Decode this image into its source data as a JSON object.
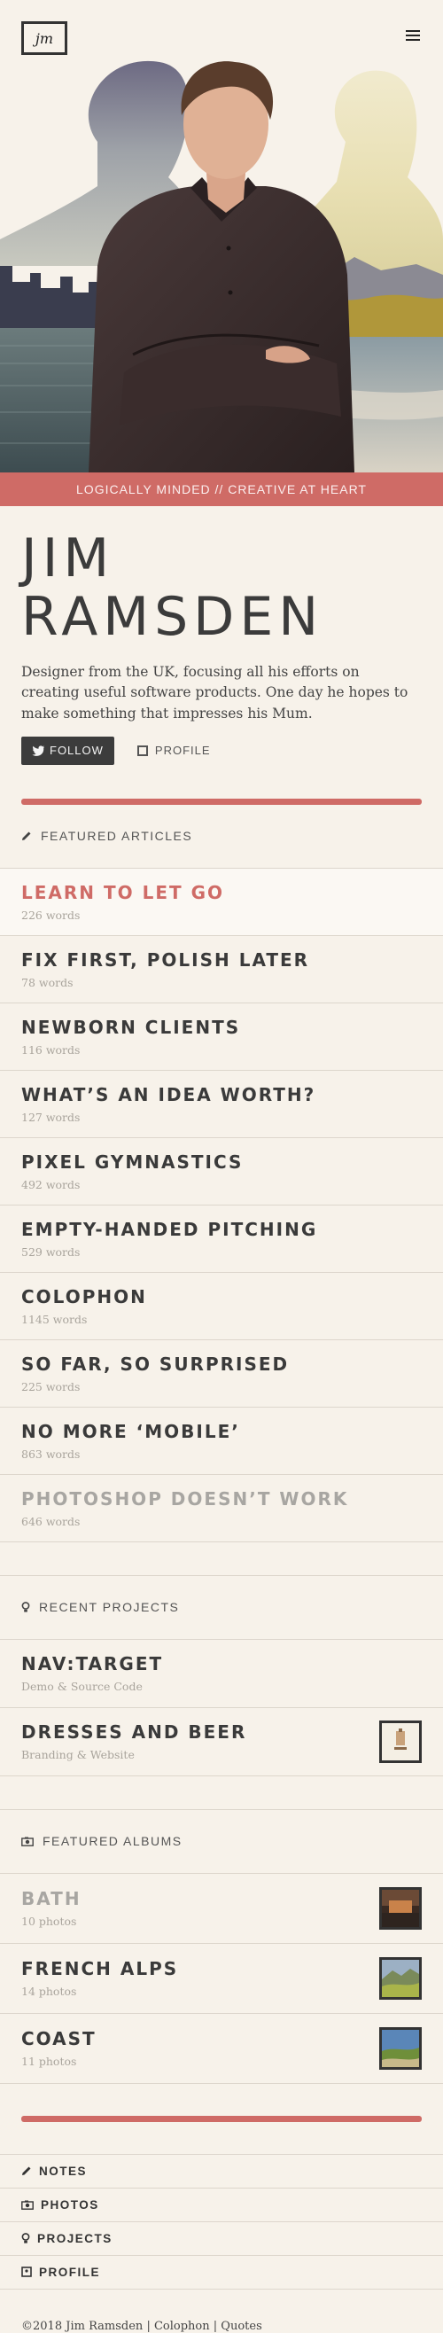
{
  "header": {
    "logo_text": "jm",
    "menu_icon": "hamburger-icon"
  },
  "tagline": "LOGICALLY MINDED // CREATIVE AT HEART",
  "intro": {
    "name": "JIM RAMSDEN",
    "bio": "Designer from the UK, focusing all his efforts on creating useful software products. One day he hopes to make something that impresses his Mum.",
    "follow_label": "FOLLOW",
    "profile_label": "PROFILE"
  },
  "articles": {
    "heading": "FEATURED ARTICLES",
    "items": [
      {
        "title": "LEARN TO LET GO",
        "words": "226 words"
      },
      {
        "title": "FIX FIRST, POLISH LATER",
        "words": "78 words"
      },
      {
        "title": "NEWBORN CLIENTS",
        "words": "116 words"
      },
      {
        "title": "WHAT’S AN IDEA WORTH?",
        "words": "127 words"
      },
      {
        "title": "PIXEL GYMNASTICS",
        "words": "492 words"
      },
      {
        "title": "EMPTY-HANDED PITCHING",
        "words": "529 words"
      },
      {
        "title": "COLOPHON",
        "words": "1145 words"
      },
      {
        "title": "SO FAR, SO SURPRISED",
        "words": "225 words"
      },
      {
        "title": "NO MORE ‘MOBILE’",
        "words": "863 words"
      },
      {
        "title": "PHOTOSHOP DOESN’T WORK",
        "words": "646 words"
      }
    ]
  },
  "projects": {
    "heading": "RECENT PROJECTS",
    "items": [
      {
        "title": "NAV:TARGET",
        "subtitle": "Demo & Source Code"
      },
      {
        "title": "DRESSES AND BEER",
        "subtitle": "Branding & Website"
      }
    ]
  },
  "albums": {
    "heading": "FEATURED ALBUMS",
    "items": [
      {
        "title": "BATH",
        "count": "10 photos"
      },
      {
        "title": "FRENCH ALPS",
        "count": "14 photos"
      },
      {
        "title": "COAST",
        "count": "11 photos"
      }
    ]
  },
  "footer_nav": [
    {
      "label": "NOTES",
      "icon": "pencil-icon"
    },
    {
      "label": "PHOTOS",
      "icon": "camera-icon"
    },
    {
      "label": "PROJECTS",
      "icon": "lightbulb-icon"
    },
    {
      "label": "PROFILE",
      "icon": "id-card-icon"
    }
  ],
  "footer": {
    "copyright": "©2018",
    "author_link": "Jim Ramsden",
    "sep1": "|",
    "colophon_link": "Colophon",
    "sep2": "|",
    "quotes_link": "Quotes"
  },
  "colors": {
    "accent": "#cf6b66",
    "background": "#f7f2ea",
    "text": "#3a3a3a",
    "muted": "#a9a49c"
  }
}
